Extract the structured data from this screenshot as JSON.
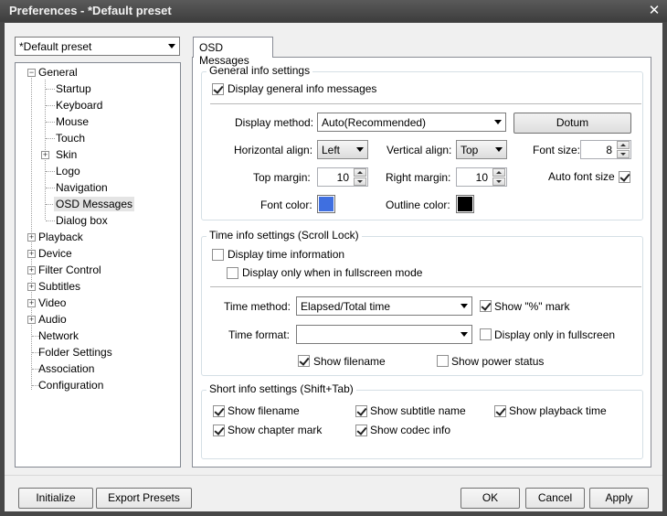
{
  "window": {
    "title": "Preferences - *Default preset",
    "close_label": "✕"
  },
  "preset": {
    "selected": "*Default preset"
  },
  "tree": {
    "items": [
      "General",
      "Startup",
      "Keyboard",
      "Mouse",
      "Touch",
      "Skin",
      "Logo",
      "Navigation",
      "OSD Messages",
      "Dialog box",
      "Playback",
      "Device",
      "Filter Control",
      "Subtitles",
      "Video",
      "Audio",
      "Network",
      "Folder Settings",
      "Association",
      "Configuration"
    ]
  },
  "tab": {
    "label": "OSD Messages"
  },
  "general": {
    "title": "General info settings",
    "display_msgs": "Display general info messages",
    "display_method_label": "Display method:",
    "display_method": "Auto(Recommended)",
    "font_button": "Dotum",
    "h_align_label": "Horizontal align:",
    "h_align": "Left",
    "v_align_label": "Vertical align:",
    "v_align": "Top",
    "font_size_label": "Font size:",
    "font_size": "8",
    "top_margin_label": "Top margin:",
    "top_margin": "10",
    "right_margin_label": "Right margin:",
    "right_margin": "10",
    "auto_font_size": "Auto font size",
    "font_color_label": "Font color:",
    "outline_color_label": "Outline color:",
    "font_color": "#3f6fe0",
    "outline_color": "#000000"
  },
  "time": {
    "title": "Time info settings (Scroll Lock)",
    "display_time": "Display time information",
    "only_fullscreen": "Display only when in fullscreen mode",
    "method_label": "Time method:",
    "method": "Elapsed/Total time",
    "show_percent": "Show \"%\" mark",
    "format_label": "Time format:",
    "format": "",
    "display_only_fullscreen": "Display only in fullscreen",
    "show_filename": "Show filename",
    "show_power": "Show power status"
  },
  "short": {
    "title": "Short info settings (Shift+Tab)",
    "show_filename": "Show filename",
    "show_subtitle": "Show subtitle name",
    "show_playback": "Show playback time",
    "show_chapter": "Show chapter mark",
    "show_codec": "Show codec info"
  },
  "footer": {
    "initialize": "Initialize",
    "export": "Export Presets",
    "ok": "OK",
    "cancel": "Cancel",
    "apply": "Apply"
  }
}
